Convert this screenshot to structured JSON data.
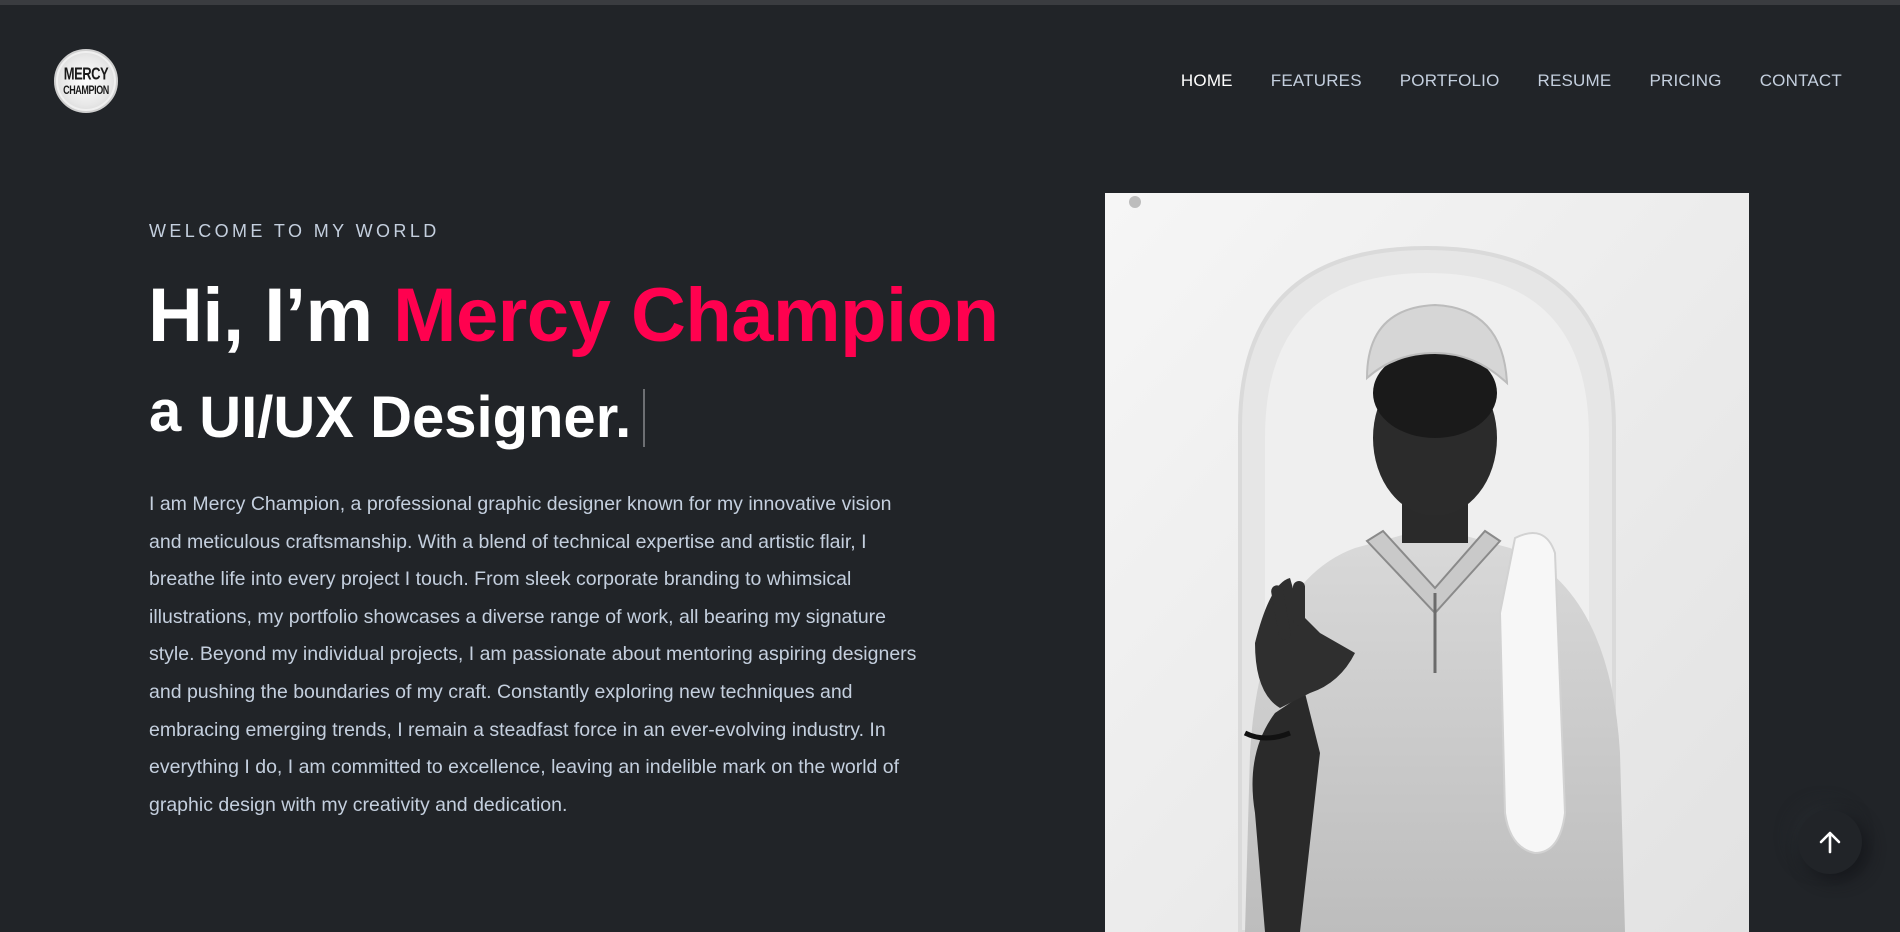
{
  "logo": {
    "line1": "MERCY",
    "line2": "CHAMPION"
  },
  "nav": {
    "items": [
      {
        "label": "HOME"
      },
      {
        "label": "FEATURES"
      },
      {
        "label": "PORTFOLIO"
      },
      {
        "label": "RESUME"
      },
      {
        "label": "PRICING"
      },
      {
        "label": "CONTACT"
      }
    ],
    "active": "HOME"
  },
  "hero": {
    "welcome": "WELCOME TO MY WORLD",
    "greeting": "Hi, I’m ",
    "name": "Mercy Champion",
    "sub_prefix": "a",
    "sub_role": "UI/UX Designer.",
    "bio": "I am Mercy Champion, a professional graphic designer known for my innovative vision and meticulous craftsmanship. With a blend of technical expertise and artistic flair, I breathe life into every project I touch. From sleek corporate branding to whimsical illustrations, my portfolio showcases a diverse range of work, all bearing my signature style. Beyond my individual projects, I am passionate about mentoring aspiring designers and pushing the boundaries of my craft. Constantly exploring new techniques and embracing emerging trends, I remain a steadfast force in an ever-evolving industry. In everything I do, I am committed to excellence, leaving an indelible mark on the world of graphic design with my creativity and dedication."
  },
  "colors": {
    "background": "#212428",
    "accent": "#ff014f",
    "text": "#c4cfde",
    "heading": "#ffffff"
  },
  "icons": {
    "back_to_top": "arrow-up-icon"
  }
}
